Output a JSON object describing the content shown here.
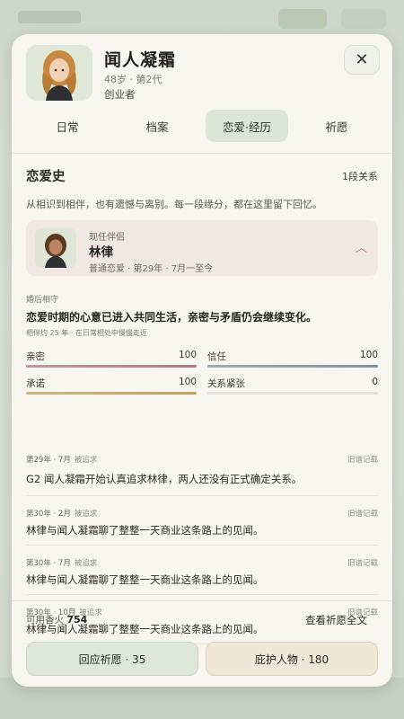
{
  "character": {
    "name": "闻人凝霜",
    "meta": "48岁 · 第2代",
    "role": "创业者"
  },
  "tabs": [
    {
      "label": "日常",
      "active": false
    },
    {
      "label": "档案",
      "active": false
    },
    {
      "label": "恋爱·经历",
      "active": true
    },
    {
      "label": "祈愿",
      "active": false
    }
  ],
  "romance": {
    "title": "恋爱史",
    "count": "1段关系",
    "intro": "从相识到相伴，也有遗憾与离别。每一段缘分，都在这里留下回忆。"
  },
  "partner": {
    "label": "现任伴侣",
    "name": "林律",
    "desc": "普通恋爱 · 第29年 · 7月一至今"
  },
  "status": {
    "small_caption": "婚后相守",
    "headline": "恋爱时期的心意已进入共同生活，亲密与矛盾仍会继续变化。",
    "subline": "相伴约 25 年 · 在日常相处中慢慢走近"
  },
  "stats": [
    {
      "label": "亲密",
      "value": "100",
      "level": 1.0,
      "color": "#b07a82"
    },
    {
      "label": "信任",
      "value": "100",
      "level": 1.0,
      "color": "#7d959a"
    },
    {
      "label": "承诺",
      "value": "100",
      "level": 1.0,
      "color": "#c4a05a"
    },
    {
      "label": "关系紧张",
      "value": "0",
      "level": 0.0,
      "color": "#c98f7c"
    }
  ],
  "feed": [
    {
      "date": "第29年 · 7月",
      "tag": "被追求",
      "source": "旧谱记载",
      "text": "G2 闻人凝霜开始认真追求林律，两人还没有正式确定关系。"
    },
    {
      "date": "第30年 · 2月",
      "tag": "被追求",
      "source": "旧谱记载",
      "text": "林律与闻人凝霜聊了整整一天商业这条路上的见闻。"
    },
    {
      "date": "第30年 · 7月",
      "tag": "被追求",
      "source": "旧谱记载",
      "text": "林律与闻人凝霜聊了整整一天商业这条路上的见闻。"
    },
    {
      "date": "第30年 · 10月",
      "tag": "被追求",
      "source": "旧谱记载",
      "text": "林律与闻人凝霜聊了整整一天商业这条路上的见闻。"
    }
  ],
  "footer": {
    "incense_label": "可用香火",
    "incense_value": "754",
    "full_text_link": "查看祈愿全文",
    "answer_button": "回应祈愿 · 35",
    "protect_button": "庇护人物 · 180"
  }
}
